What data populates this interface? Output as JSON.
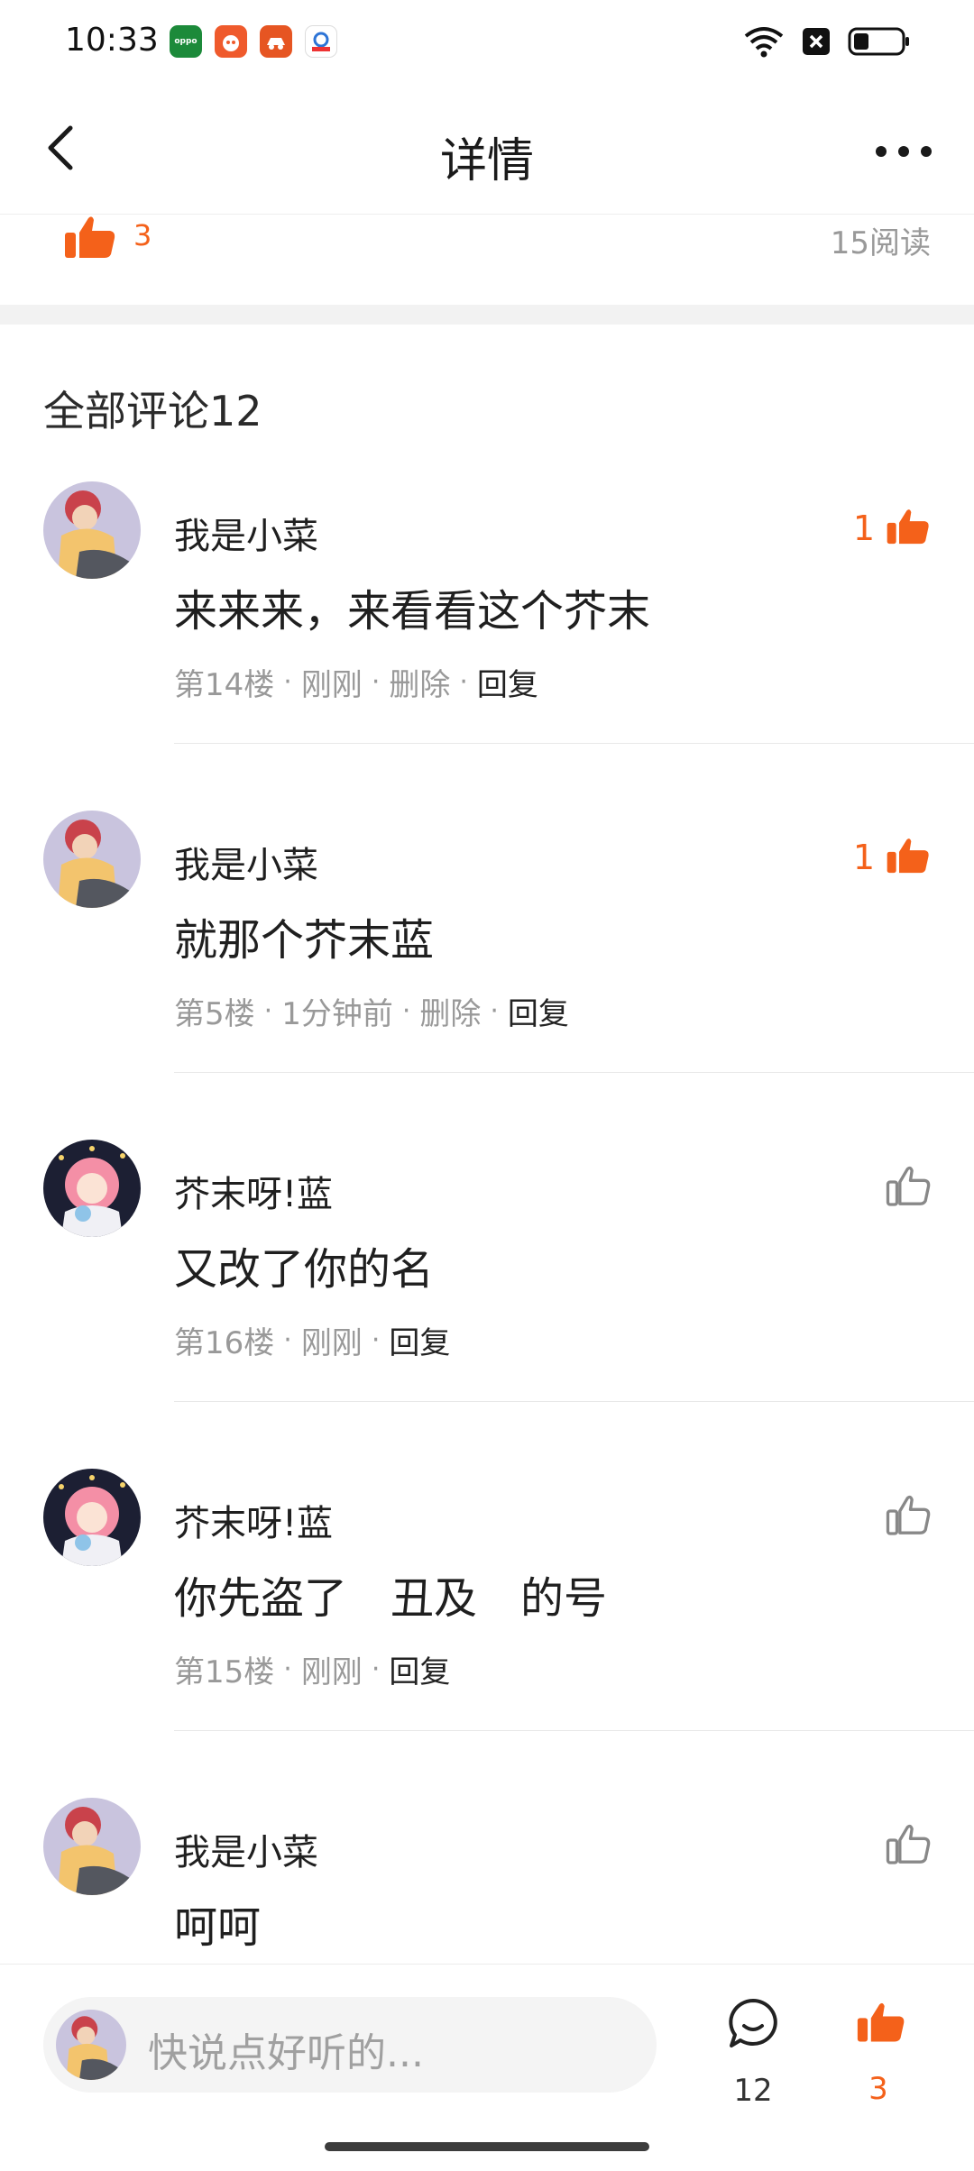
{
  "status_bar": {
    "time": "10:33",
    "app_icons": [
      {
        "name": "oppo-app-icon",
        "label": "oppo",
        "color": "#1c8a3a"
      },
      {
        "name": "shop-app-icon",
        "label": "",
        "color": "#ef5a2c"
      },
      {
        "name": "car-app-icon",
        "label": "",
        "color": "#e65522"
      },
      {
        "name": "cntv-app-icon",
        "label": "",
        "color": "#2d74d6"
      }
    ]
  },
  "header": {
    "title": "详情"
  },
  "post_meta": {
    "likes": "3",
    "reads": "15阅读"
  },
  "comments_section": {
    "title": "全部评论12"
  },
  "comments": [
    {
      "author": "我是小菜",
      "text": "来来来，来看看这个芥末",
      "floor": "第14楼",
      "time": "刚刚",
      "delete_label": "删除",
      "reply_label": "回复",
      "likes": "1",
      "liked": true,
      "avatar_type": "boy"
    },
    {
      "author": "我是小菜",
      "text": "就那个芥末蓝",
      "floor": "第5楼",
      "time": "1分钟前",
      "delete_label": "删除",
      "reply_label": "回复",
      "likes": "1",
      "liked": true,
      "avatar_type": "boy"
    },
    {
      "author": "芥末呀!蓝",
      "text": "又改了你的名",
      "floor": "第16楼",
      "time": "刚刚",
      "reply_label": "回复",
      "likes": "",
      "liked": false,
      "avatar_type": "girl"
    },
    {
      "author": "芥末呀!蓝",
      "text": "你先盗了　丑及　的号",
      "floor": "第15楼",
      "time": "刚刚",
      "reply_label": "回复",
      "likes": "",
      "liked": false,
      "avatar_type": "girl"
    },
    {
      "author": "我是小菜",
      "text": "呵呵",
      "floor": "",
      "time": "",
      "reply_label": "",
      "likes": "",
      "liked": false,
      "avatar_type": "boy"
    }
  ],
  "bottom_bar": {
    "placeholder": "快说点好听的...",
    "comment_count": "12",
    "like_count": "3"
  },
  "colors": {
    "accent": "#f4611a",
    "muted": "#999999"
  }
}
